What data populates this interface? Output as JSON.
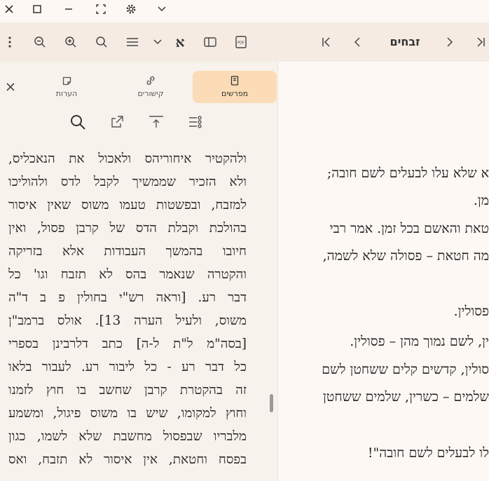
{
  "window": {
    "title": ""
  },
  "toolbar": {
    "book_title": "זבחים"
  },
  "tabs": [
    {
      "label": "מפרשים",
      "icon": "book-icon"
    },
    {
      "label": "קישורים",
      "icon": "link-icon"
    },
    {
      "label": "הערות",
      "icon": "note-icon"
    }
  ],
  "commentary": {
    "lines": [
      "ולהקטיר איחוריהס ולאכול את הנאכליס,",
      "ולא הזכיר שממשיך לקבל לדס ולהוליכו",
      "למזבח, ובפשטות טעמו משוס שאין איסור",
      "בהולכת וקבלת הדס של קרבן פסול, ואין",
      "חיובו בהמשך העבודות אלא בזריקה",
      "והקטרה שנאמר בהס לא תזבח וגו' כל",
      "דבר רע. [וראה רש\"י בחולין פ ב ד\"ה",
      "משוס, ולעיל הערה 13]. אולס ברמב\"ן",
      "[בסה\"מ ל\"ת ל-ה] כתב דלרבינן בספרי",
      "כל דבר רע - כל ליבור רע. לעבור בלאו",
      "זה בהקטרת קרבן שחשב בו חוץ לזמנו",
      "וחוץ למקומו, שיש בו משוס פיגול, ומשמע",
      "מלבריו שבפסול מחשבת שלא לשמו, כגון",
      "בפסח וחטאת, אין איסור לא תזבח, ואס"
    ]
  },
  "main": {
    "lines": [
      "א שלא עלו לבעלים לשם חובה;",
      "מן.",
      "טאת והאשם בכל זמן. אמר רבי",
      "מה חטאת – פסולה שלא לשמה,",
      "פסולין.",
      "ין, לשם נמוך מהן – פסולין.",
      "סולין, קדשים קלים ששחטן לשם",
      "שלמים – כשרין, שלמים ששחטן",
      "לו לבעלים לשם חובה\"!"
    ]
  }
}
